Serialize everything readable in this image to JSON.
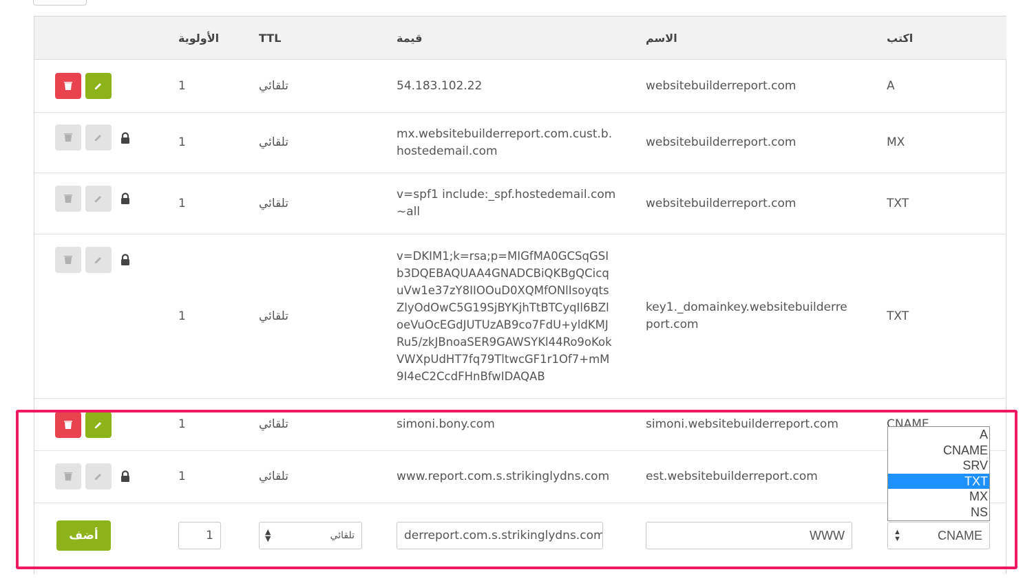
{
  "headers": {
    "type": "اكتب",
    "name": "الاسم",
    "value": "قيمة",
    "ttl": "TTL",
    "priority": "الأولوية"
  },
  "records": [
    {
      "type": "A",
      "name": "websitebuilderreport.com",
      "value": "54.183.102.22",
      "ttl": "تلقائي",
      "priority": "1",
      "locked": false
    },
    {
      "type": "MX",
      "name": "websitebuilderreport.com",
      "value": "mx.websitebuilderreport.com.cust.b.hostedemail.com",
      "ttl": "تلقائي",
      "priority": "1",
      "locked": true
    },
    {
      "type": "TXT",
      "name": "websitebuilderreport.com",
      "value": "v=spf1 include:_spf.hostedemail.com ~all",
      "ttl": "تلقائي",
      "priority": "1",
      "locked": true
    },
    {
      "type": "TXT",
      "name": "key1._domainkey.websitebuilderreport.com",
      "value": "v=DKIM1;k=rsa;p=MIGfMA0GCSqGSIb3DQEBAQUAA4GNADCBiQKBgQCicquVw1e37zY8IIOOuD0XQMfONlIsoyqtsZlyOdOwC5G19SjBYKjhTtBTCyqIl6BZloeVuOcEGdJUTUzAB9co7FdU+yldKMJRu5/zkJBnoaSER9GAWSYKl44Ro9oKokVWXpUdHT7fq79TltwcGF1r1Of7+mM9I4eC2CcdFHnBfwIDAQAB",
      "ttl": "تلقائي",
      "priority": "1",
      "locked": true
    },
    {
      "type": "CNAME",
      "name": "simoni.websitebuilderreport.com",
      "value": "simoni.bony.com",
      "ttl": "تلقائي",
      "priority": "1",
      "locked": false
    },
    {
      "type": "",
      "name": "est.websitebuilderreport.com",
      "value": "www.report.com.s.strikinglydns.com",
      "ttl": "تلقائي",
      "priority": "1",
      "locked": true
    }
  ],
  "new_record": {
    "add_label": "أضف",
    "priority": "1",
    "ttl_selected": "تلقائي",
    "value": "derreport.com.s.strikinglydns.com",
    "name": "WWW",
    "type_selected": "CNAME"
  },
  "type_dropdown": {
    "options": [
      "A",
      "CNAME",
      "SRV",
      "TXT",
      "MX",
      "NS"
    ],
    "highlighted": "TXT"
  },
  "colors": {
    "delete": "#e9434f",
    "edit": "#8cb319",
    "highlight_border": "#f0185f",
    "dropdown_selected": "#1e90ff"
  }
}
